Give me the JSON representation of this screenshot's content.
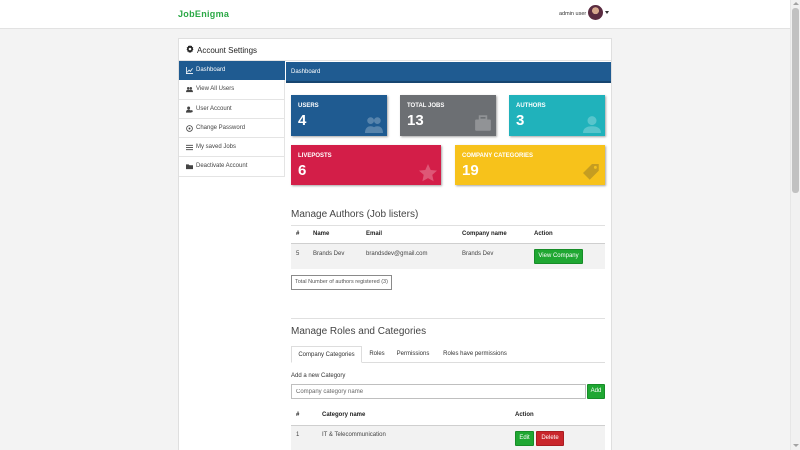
{
  "navbar": {
    "brand": "JobEnigma",
    "user_name": "admin user"
  },
  "card": {
    "title": "Account Settings"
  },
  "sidebar": {
    "items": [
      {
        "label": "Dashboard",
        "icon": "chart-icon",
        "active": true
      },
      {
        "label": "View All Users",
        "icon": "users-icon"
      },
      {
        "label": "User Account",
        "icon": "user-cog-icon"
      },
      {
        "label": "Change Password",
        "icon": "key-icon"
      },
      {
        "label": "My saved Jobs",
        "icon": "list-icon"
      },
      {
        "label": "Deactivate Account",
        "icon": "folder-icon"
      }
    ]
  },
  "content": {
    "header": "Dashboard"
  },
  "stats": [
    {
      "label": "USERS",
      "value": "4",
      "color": "#1f5b91"
    },
    {
      "label": "TOTAL JOBS",
      "value": "13",
      "color": "#6c6f73"
    },
    {
      "label": "AUTHORS",
      "value": "3",
      "color": "#20b2bb"
    },
    {
      "label": "LIVEPOSTS",
      "value": "6",
      "color": "#d31e48"
    },
    {
      "label": "COMPANY CATEGORIES",
      "value": "19",
      "color": "#f7c21b"
    }
  ],
  "authors": {
    "title": "Manage Authors (Job listers)",
    "columns": [
      "#",
      "Name",
      "Email",
      "Company name",
      "Action"
    ],
    "rows": [
      {
        "id": "5",
        "name": "Brands Dev",
        "email": "brandsdev@gmail.com",
        "company": "Brands Dev",
        "action": "View Company"
      }
    ],
    "total_badge": "Total Number of authors registered (3)"
  },
  "roles": {
    "title": "Manage Roles and Categories",
    "tabs": [
      "Company Categories",
      "Roles",
      "Permissions",
      "Roles have permissions"
    ],
    "add_label": "Add a new Category",
    "input_placeholder": "Company category name",
    "add_button": "Add",
    "columns": [
      "#",
      "Category name",
      "Action"
    ],
    "rows": [
      {
        "id": "1",
        "name": "IT & Telecommunication",
        "edit": "Edit",
        "delete": "Delete"
      }
    ]
  }
}
